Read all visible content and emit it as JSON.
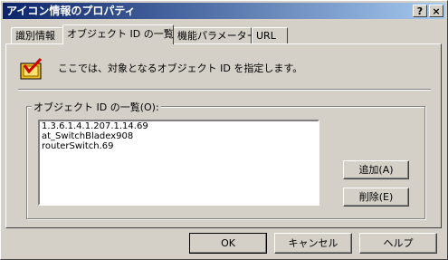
{
  "window": {
    "title": "アイコン情報のプロパティ",
    "help": "?",
    "close": "×"
  },
  "tabs": [
    {
      "label": "識別情報"
    },
    {
      "label": "オブジェクト ID の一覧"
    },
    {
      "label": "機能パラメーター"
    },
    {
      "label": "URL"
    }
  ],
  "panel": {
    "description": "ここでは、対象となるオブジェクト ID を指定します。",
    "group_label": "オブジェクト ID の一覧(O):",
    "list_items": [
      "1.3.6.1.4.1.207.1.14.69",
      "at_SwitchBladex908",
      "routerSwitch.69"
    ],
    "add_button": "追加(A)",
    "delete_button": "削除(E)"
  },
  "footer": {
    "ok": "OK",
    "cancel": "キャンセル",
    "help": "ヘルプ"
  },
  "colors": {
    "titlebar_start": "#0a246a",
    "titlebar_end": "#a6caf0",
    "face": "#d4d0c8"
  },
  "icons": {
    "app": "checkmark-box-icon"
  }
}
